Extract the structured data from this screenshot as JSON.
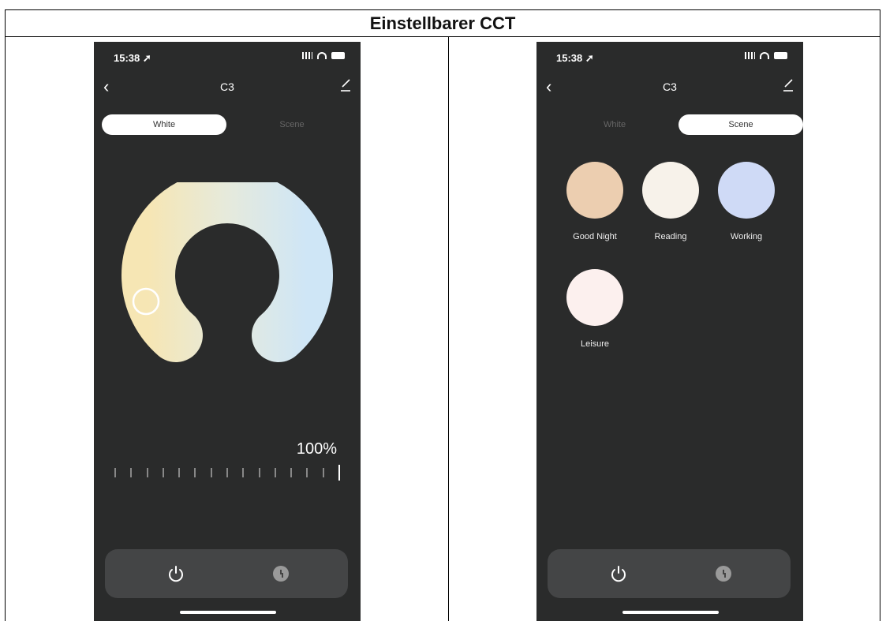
{
  "table": {
    "title": "Einstellbarer CCT"
  },
  "left": {
    "status_time": "15:38",
    "title": "C3",
    "tabs": [
      {
        "label": "White",
        "active": true
      },
      {
        "label": "Scene",
        "active": false
      }
    ],
    "brightness": "100%",
    "brightness_value": 1.0,
    "tick_count": 15
  },
  "right": {
    "status_time": "15:38",
    "title": "C3",
    "tabs": [
      {
        "label": "White",
        "active": false
      },
      {
        "label": "Scene",
        "active": true
      }
    ],
    "scenes": [
      {
        "label": "Good Night",
        "color": "#ecceb0"
      },
      {
        "label": "Reading",
        "color": "#f7f2ea"
      },
      {
        "label": "Working",
        "color": "#cfdaf6"
      },
      {
        "label": "Leisure",
        "color": "#fcf0ee"
      }
    ]
  },
  "colors": {
    "phone_bg": "#2a2b2b",
    "bar_bg": "#444546",
    "warm": "#f6e6b4",
    "cool": "#cfe6f6"
  },
  "icons": [
    "back-icon",
    "edit-icon",
    "power-icon",
    "clock-icon",
    "signal-icon",
    "wifi-icon",
    "battery-icon",
    "location-arrow-icon"
  ]
}
